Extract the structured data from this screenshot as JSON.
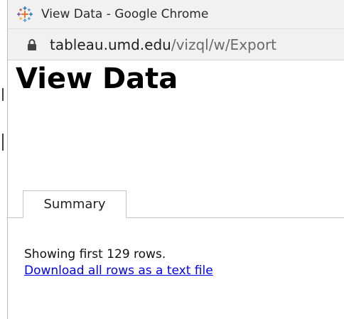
{
  "window": {
    "title": "View Data - Google Chrome",
    "app_icon": "tableau-logo-icon"
  },
  "address_bar": {
    "lock_icon": "lock-icon",
    "host": "tableau.umd.edu",
    "path": "/vizql/w/Export"
  },
  "page": {
    "title": "View Data",
    "tabs": [
      {
        "label": "Summary",
        "selected": true
      }
    ],
    "status_text": "Showing first 129 rows.",
    "download_link_text": "Download all rows as a text file"
  },
  "colors": {
    "link": "#0000ee",
    "chrome_bar": "#f1f1f1",
    "tableau_blue": "#1f77b4",
    "tableau_orange": "#e8762b",
    "tableau_teal": "#5b9bd5",
    "tableau_purple": "#7b4f9e"
  }
}
